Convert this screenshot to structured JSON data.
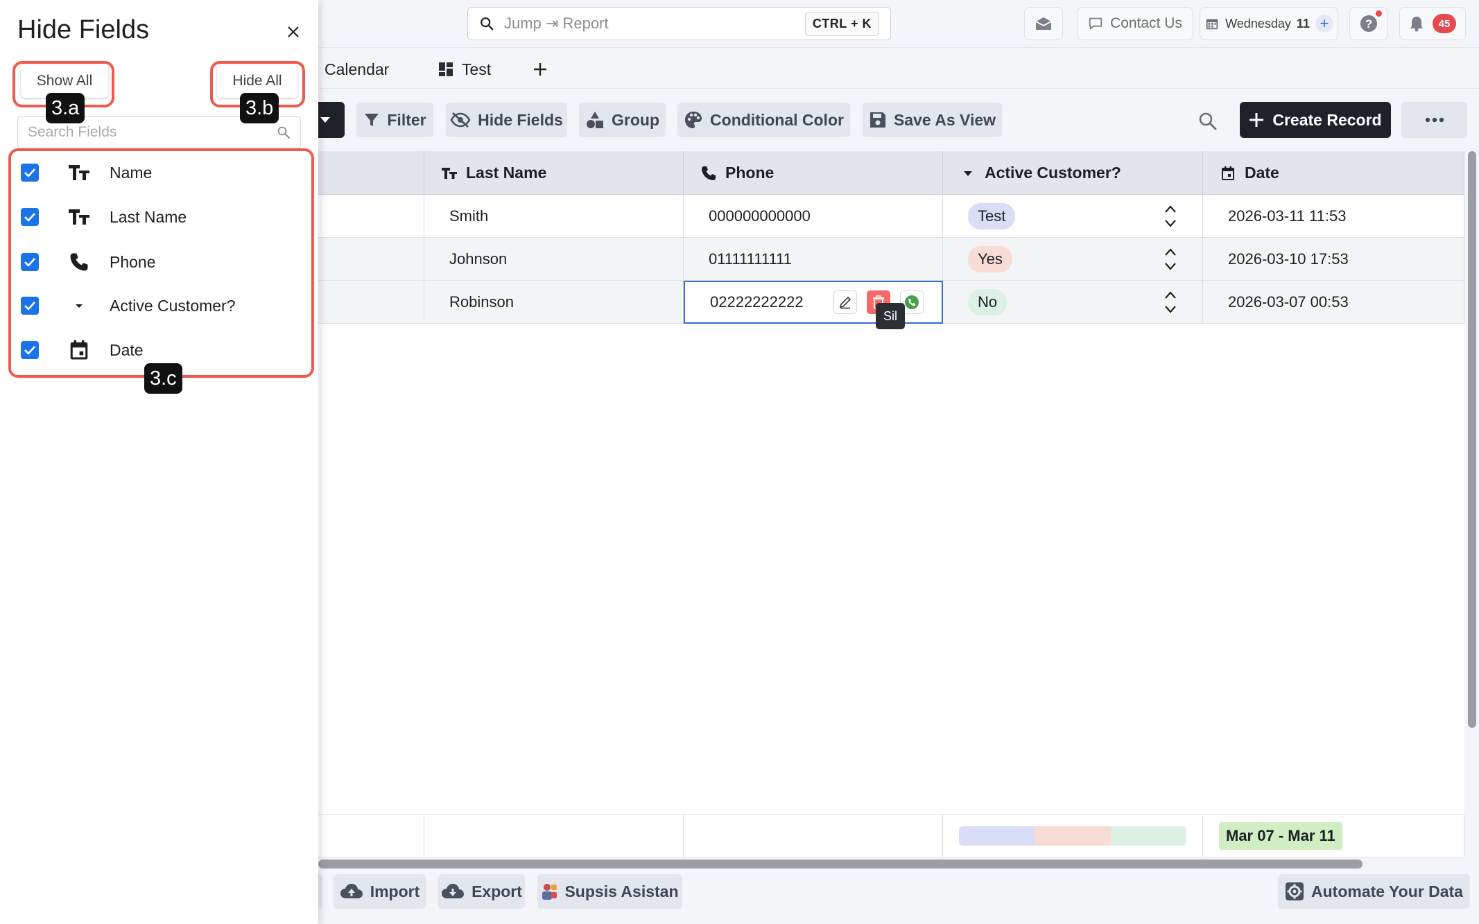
{
  "topbar": {
    "search_placeholder": "Jump ⇥ Report",
    "shortcut": "CTRL + K",
    "contact_label": "Contact Us",
    "calendar_day": "Wednesday",
    "calendar_date": "11",
    "notifications_count": "45"
  },
  "tabs": [
    {
      "label": "Calendar"
    },
    {
      "label": "Test"
    }
  ],
  "toolbar": {
    "filter": "Filter",
    "hide_fields": "Hide Fields",
    "group": "Group",
    "conditional_color": "Conditional Color",
    "save_as_view": "Save As View",
    "create_record": "Create Record"
  },
  "table": {
    "columns": [
      {
        "label": "Last Name",
        "icon": "text-type-icon"
      },
      {
        "label": "Phone",
        "icon": "phone-icon"
      },
      {
        "label": "Active Customer?",
        "icon": "dropdown-icon"
      },
      {
        "label": "Date",
        "icon": "calendar-icon"
      }
    ],
    "rows": [
      {
        "last_name": "Smith",
        "phone": "000000000000",
        "active": "Test",
        "date": "2026-03-11 11:53"
      },
      {
        "last_name": "Johnson",
        "phone": "01111111111",
        "active": "Yes",
        "date": "2026-03-10 17:53"
      },
      {
        "last_name": "Robinson",
        "phone": "02222222222",
        "active": "No",
        "date": "2026-03-07 00:53"
      }
    ],
    "tooltip": "Sil",
    "footer_date_range": "Mar 07 - Mar 11"
  },
  "status_colors": {
    "Test": "#d9ddf5",
    "Yes": "#f8dcd6",
    "No": "#dcf1e3"
  },
  "bottombar": {
    "import": "Import",
    "export": "Export",
    "assistant": "Supsis Asistan",
    "automate": "Automate Your Data"
  },
  "panel": {
    "title": "Hide Fields",
    "show_all": "Show All",
    "hide_all": "Hide All",
    "search_placeholder": "Search Fields",
    "fields": [
      {
        "label": "Name",
        "icon": "text-type-icon",
        "checked": true
      },
      {
        "label": "Last Name",
        "icon": "text-type-icon",
        "checked": true
      },
      {
        "label": "Phone",
        "icon": "phone-icon",
        "checked": true
      },
      {
        "label": "Active Customer?",
        "icon": "dropdown-icon",
        "checked": true
      },
      {
        "label": "Date",
        "icon": "calendar-icon",
        "checked": true
      }
    ]
  },
  "annotations": {
    "a": "3.a",
    "b": "3.b",
    "c": "3.c"
  },
  "colors": {
    "accent": "#1a73e8",
    "annotation": "#ef5a4e",
    "dark_button": "#1f2228"
  }
}
